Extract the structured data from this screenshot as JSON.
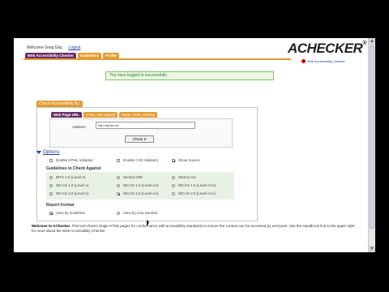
{
  "topbar": {
    "welcome": "Welcome Greg Gay",
    "logout": "Logout"
  },
  "tabs": [
    "Web Accessibility Checker",
    "Guidelines",
    "Profile"
  ],
  "logo": {
    "text": "ACHECKER",
    "reg": "®",
    "subtitle": "Web Accessibility Checker"
  },
  "success_message": "You have logged in successfully.",
  "panel": {
    "title": "Check Accessibility By:",
    "tabs": [
      "Web Page URL",
      "HTML File Upload",
      "Paste HTML Markup"
    ],
    "address_label": "Address:",
    "address_value": "http://atutor.ca",
    "check_button": "Check It"
  },
  "options": {
    "link": "Options",
    "checks": [
      {
        "label": "Enable HTML Validator",
        "checked": false
      },
      {
        "label": "Enable CSS Validator",
        "checked": false
      },
      {
        "label": "Show Source",
        "checked": true
      }
    ],
    "guidelines_title": "Guidelines to Check Against",
    "guidelines": [
      {
        "label": "BITV 1.0 (Level 2)",
        "checked": false
      },
      {
        "label": "Section 508",
        "checked": false
      },
      {
        "label": "Stanca Act",
        "checked": false
      },
      {
        "label": "WCAG 1.0 (Level A)",
        "checked": false
      },
      {
        "label": "WCAG 1.0 (Level AA)",
        "checked": false
      },
      {
        "label": "WCAG 1.0 (Level AAA)",
        "checked": false
      },
      {
        "label": "WCAG 2.0 (Level A)",
        "checked": false
      },
      {
        "label": "WCAG 2.0 (Level AA)",
        "checked": true
      },
      {
        "label": "WCAG 2.0 (Level AAA)",
        "checked": false
      }
    ],
    "report_title": "Report Format",
    "report": [
      {
        "label": "View by Guideline",
        "checked": true
      },
      {
        "label": "View by Line Number",
        "checked": false
      }
    ]
  },
  "welcome": {
    "bold": "Welcome to AChecker.",
    "text": " This tool checks single HTML pages for conformance with accessibility standards to ensure the content can be accessed by everyone. Use the Handbook link to the upper right for more about the Web Accessibility Checker."
  },
  "colors": {
    "purple": "#6a2e67",
    "orange": "#e49b2e",
    "success_green": "#2f7e2f"
  }
}
